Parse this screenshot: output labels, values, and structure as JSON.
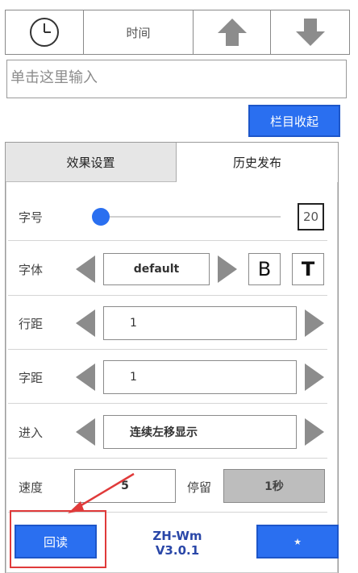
{
  "toolbar": {
    "time_label": "时间",
    "icons": [
      "clock-icon",
      "arrow-up-icon",
      "arrow-down-icon"
    ]
  },
  "input": {
    "placeholder": "单击这里输入"
  },
  "collapse_button": "栏目收起",
  "tabs": {
    "effect": "效果设置",
    "history": "历史发布"
  },
  "rows": {
    "font_size": {
      "label": "字号",
      "value": "20",
      "slider_level": 0.0
    },
    "font": {
      "label": "字体",
      "value": "default",
      "bold": "B",
      "text": "T"
    },
    "line_spacing": {
      "label": "行距",
      "value": "1"
    },
    "char_spacing": {
      "label": "字距",
      "value": "1"
    },
    "enter": {
      "label": "进入",
      "value": "连续左移显示"
    },
    "speed": {
      "label": "速度",
      "value": "5",
      "stay_label": "停留",
      "stay_value": "1秒"
    }
  },
  "bottom": {
    "readback": "回读",
    "version_name": "ZH-Wm",
    "version_number": "V3.0.1"
  },
  "colors": {
    "accent": "#2a6ff0",
    "highlight": "#e03a3a"
  }
}
